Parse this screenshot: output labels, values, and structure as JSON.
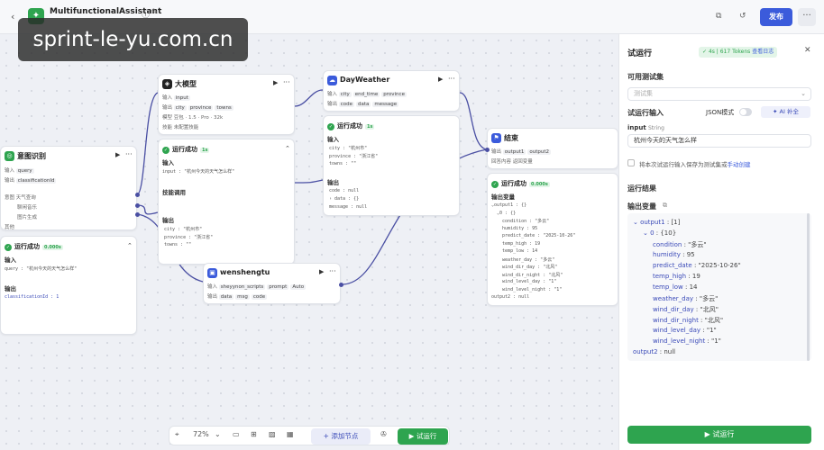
{
  "header": {
    "app_name": "MultifunctionalAssistant",
    "subtitle": "自动保存于 10:36:24",
    "tokens_hint": "4s | 617 Tokens",
    "publish_label": "发布"
  },
  "watermark": "sprint-le-yu.com.cn",
  "nodes": {
    "intent": {
      "title": "意图识别",
      "input_label": "输入",
      "input_var": "query",
      "output_label": "输出",
      "output_var": "classificationId",
      "intents_label": "意图",
      "intents": [
        "天气查询",
        "聊闲音乐",
        "图片生成"
      ],
      "other_label": "其他",
      "run_status": "运行成功",
      "run_time": "0.000s",
      "run_input_label": "输入",
      "run_input_value": "query : \"杭州今天的天气怎么样\"",
      "run_output_label": "输出",
      "run_output_value": "classificationId : 1"
    },
    "llm": {
      "title": "大模型",
      "input_label": "输入",
      "input_var": "input",
      "output_label": "输出",
      "output_vars": [
        "city",
        "province",
        "towns"
      ],
      "model_label": "模型",
      "model_value": "豆包 · 1.5 · Pro · 32k",
      "skill_label": "技能",
      "skill_value": "未配置技能",
      "run_status": "运行成功",
      "run_time": "1s",
      "run_input_label": "输入",
      "run_input_value": "input : \"杭州今天的天气怎么样\"",
      "skill_call_label": "技能调用",
      "run_output_label": "输出",
      "run_output_lines": [
        "city : \"杭州市\"",
        "province : \"浙江省\"",
        "towns : \"\""
      ]
    },
    "dayweather": {
      "title": "DayWeather",
      "input_label": "输入",
      "input_vars": [
        "city",
        "end_time",
        "province"
      ],
      "output_label": "输出",
      "output_vars": [
        "code",
        "data",
        "message"
      ],
      "run_status": "运行成功",
      "run_time": "1s",
      "run_input_label": "输入",
      "run_input_lines": [
        "city : \"杭州市\"",
        "province : \"浙江省\"",
        "towns : \"\""
      ],
      "run_output_label": "输出",
      "run_output_lines": [
        "code : null",
        "› data : {}",
        "message : null"
      ]
    },
    "wenshengtu": {
      "title": "wenshengtu",
      "input_label": "输入",
      "input_vars": [
        "sheyynon_scripts",
        "prompt",
        "Auto"
      ],
      "output_label": "输出",
      "output_vars": [
        "data",
        "msg",
        "code"
      ]
    },
    "end": {
      "title": "结束",
      "output_label": "输出",
      "output_vars": [
        "output1",
        "output2"
      ],
      "answer_label": "回答内容",
      "answer_value": "返回变量",
      "run_status": "运行成功",
      "run_time": "0.000s",
      "run_output_label": "输出变量",
      "run_output_lines": [
        "⌄output1 : {}",
        "  ⌄0 : {}",
        "    condition : \"多云\"",
        "    humidity : 95",
        "    predict_date : \"2025-10-26\"",
        "    temp_high : 19",
        "    temp_low : 14",
        "    weather_day : \"多云\"",
        "    wind_dir_day : \"北风\"",
        "    wind_dir_night : \"北风\"",
        "    wind_level_day : \"1\"",
        "    wind_level_night : \"1\"",
        "output2 : null"
      ]
    }
  },
  "toolbar": {
    "zoom": "72%",
    "add_node_label": "添加节点",
    "test_run_label": "试运行"
  },
  "panel": {
    "title": "试运行",
    "status_text": "4s | 617 Tokens",
    "view_log": "查看日志",
    "dataset_label": "可用测试集",
    "dataset_placeholder": "测试集",
    "run_input_label": "试运行输入",
    "json_mode_label": "JSON模式",
    "ai_fill_label": "AI 补全",
    "input_name": "input",
    "input_type": "String",
    "input_value": "杭州今天的天气怎么样",
    "save_checkbox_label": "将本次试运行输入保存为测试集或",
    "save_link": "手动创建",
    "result_label": "运行结果",
    "output_vars_label": "输出变量",
    "tree": [
      {
        "k": "output1",
        "v": "[1]",
        "indent": 0,
        "caret": true
      },
      {
        "k": "0",
        "v": "{10}",
        "indent": 1,
        "caret": true
      },
      {
        "k": "condition",
        "v": "\"多云\"",
        "indent": 2
      },
      {
        "k": "humidity",
        "v": "95",
        "indent": 2
      },
      {
        "k": "predict_date",
        "v": "\"2025-10-26\"",
        "indent": 2
      },
      {
        "k": "temp_high",
        "v": "19",
        "indent": 2
      },
      {
        "k": "temp_low",
        "v": "14",
        "indent": 2
      },
      {
        "k": "weather_day",
        "v": "\"多云\"",
        "indent": 2
      },
      {
        "k": "wind_dir_day",
        "v": "\"北风\"",
        "indent": 2
      },
      {
        "k": "wind_dir_night",
        "v": "\"北风\"",
        "indent": 2
      },
      {
        "k": "wind_level_day",
        "v": "\"1\"",
        "indent": 2
      },
      {
        "k": "wind_level_night",
        "v": "\"1\"",
        "indent": 2
      },
      {
        "k": "output2",
        "v": "null",
        "indent": 0
      }
    ],
    "run_button_label": "试运行"
  },
  "colors": {
    "primary": "#3b5bdb",
    "success": "#2ea44f",
    "edge": "#4a4fa3"
  }
}
